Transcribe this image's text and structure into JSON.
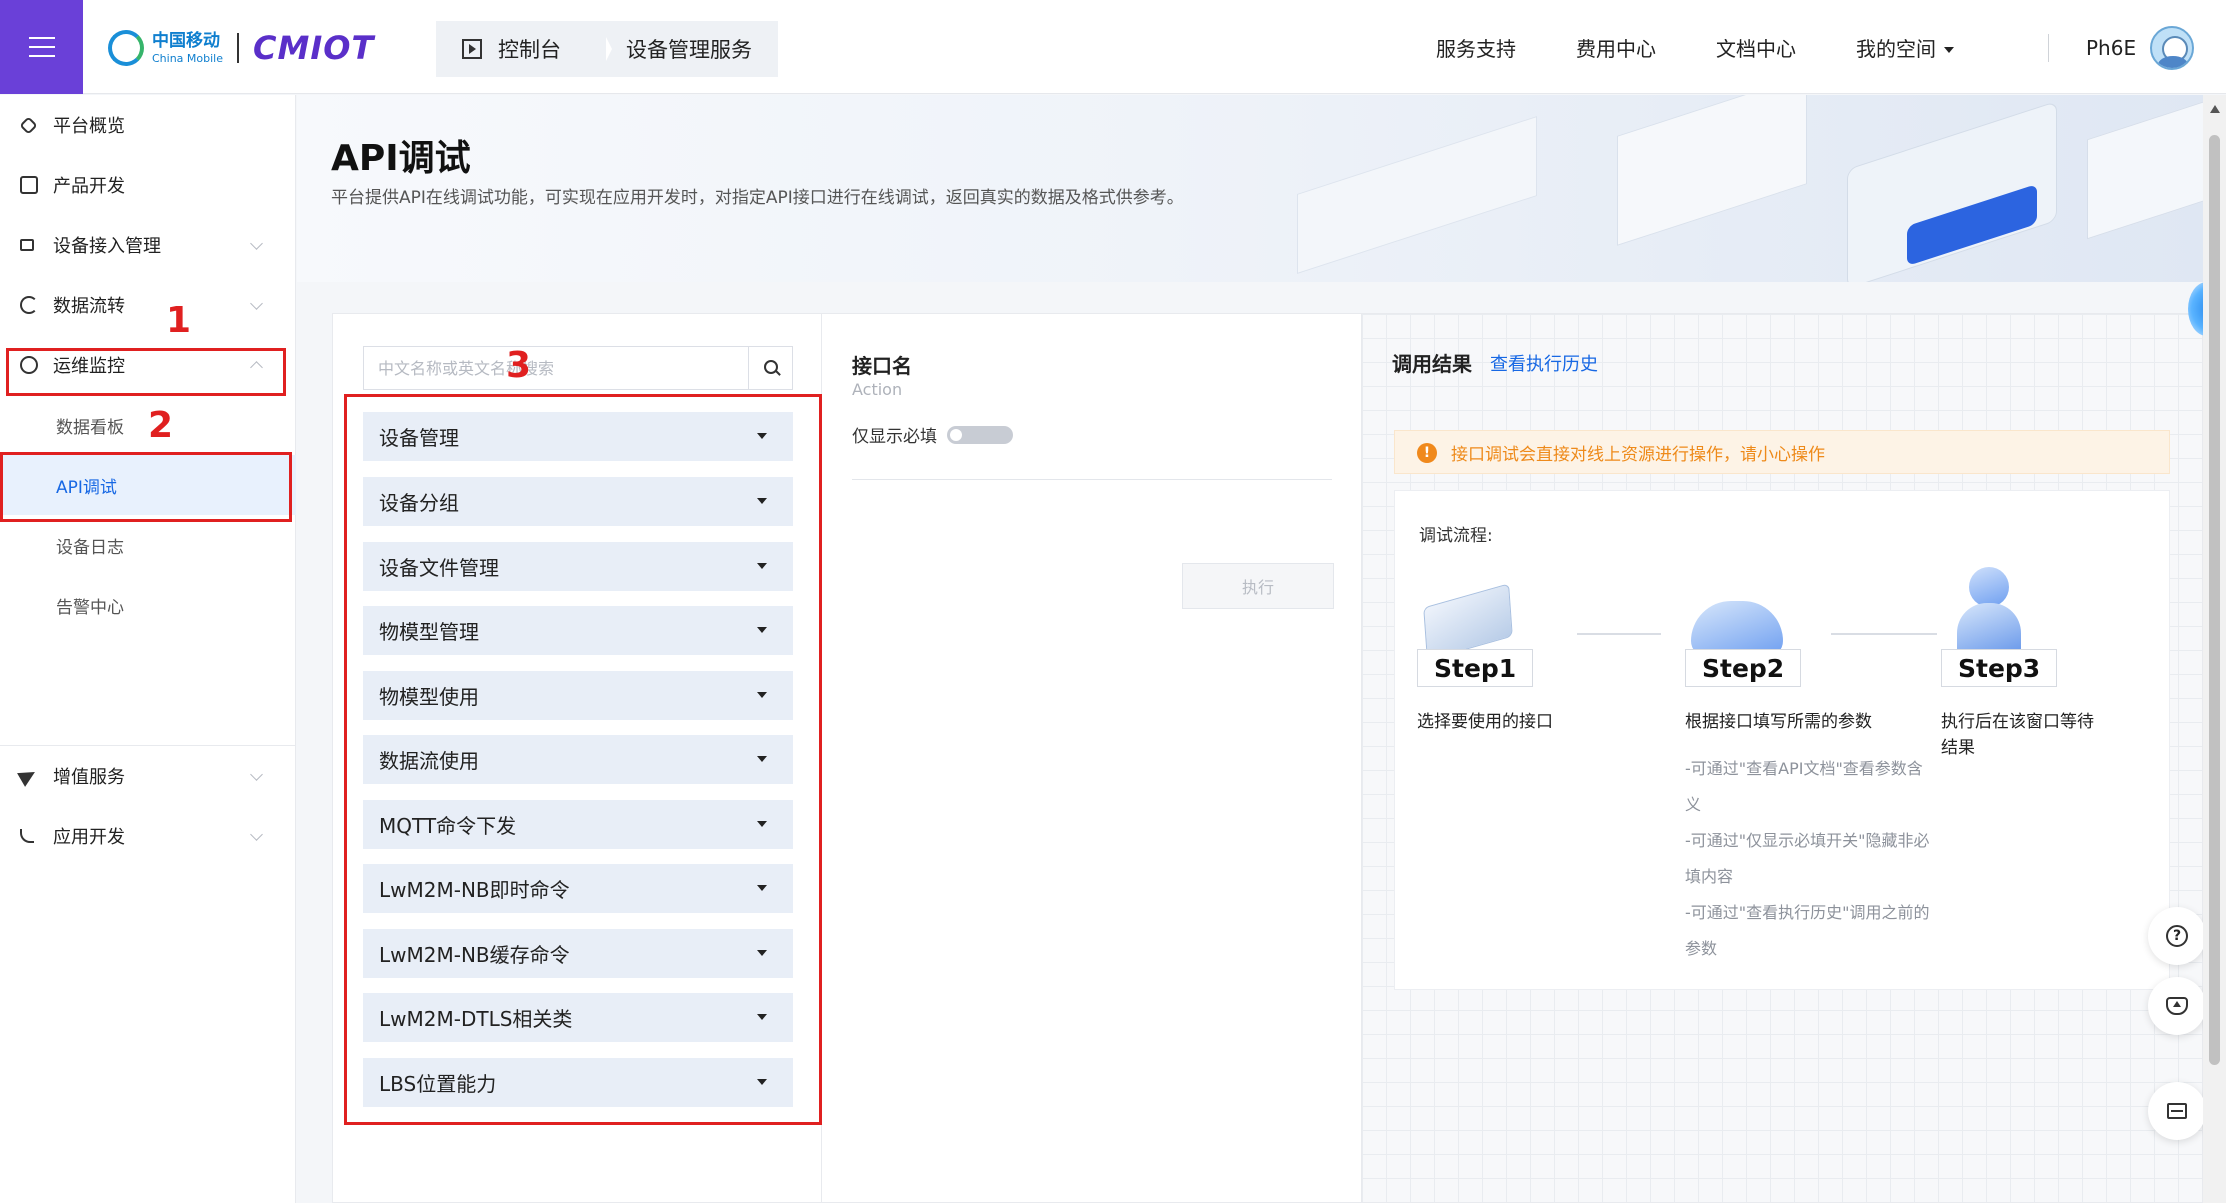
{
  "header": {
    "logo_cn": "中国移动",
    "logo_en": "China Mobile",
    "brand": "CMIOT",
    "breadcrumb": [
      "控制台",
      "设备管理服务"
    ],
    "nav": [
      "服务支持",
      "费用中心",
      "文档中心",
      "我的空间"
    ],
    "user_name": "Ph6E"
  },
  "sidebar": {
    "items": [
      {
        "label": "平台概览",
        "icon": "platform-overview-icon"
      },
      {
        "label": "产品开发",
        "icon": "cube-icon"
      },
      {
        "label": "设备接入管理",
        "icon": "device-access-icon"
      },
      {
        "label": "数据流转",
        "icon": "data-flow-icon"
      },
      {
        "label": "运维监控",
        "icon": "monitor-icon"
      }
    ],
    "sub_items": [
      "数据看板",
      "API调试",
      "设备日志",
      "告警中心"
    ],
    "bottom_items": [
      {
        "label": "增值服务",
        "icon": "send-icon"
      },
      {
        "label": "应用开发",
        "icon": "app-dev-icon"
      }
    ],
    "active_sub": "API调试"
  },
  "annotations": [
    "1",
    "2",
    "3"
  ],
  "banner": {
    "title": "API调试",
    "description": "平台提供API在线调试功能，可实现在应用开发时，对指定API接口进行在线调试，返回真实的数据及格式供参考。"
  },
  "api_list": {
    "search_placeholder": "中文名称或英文名称搜索",
    "categories": [
      "设备管理",
      "设备分组",
      "设备文件管理",
      "物模型管理",
      "物模型使用",
      "数据流使用",
      "MQTT命令下发",
      "LwM2M-NB即时命令",
      "LwM2M-NB缓存命令",
      "LwM2M-DTLS相关类",
      "LBS位置能力"
    ]
  },
  "api_detail": {
    "title": "接口名",
    "subtitle": "Action",
    "required_toggle_label": "仅显示必填",
    "execute_label": "执行"
  },
  "result": {
    "title": "调用结果",
    "history_link": "查看执行历史",
    "warning": "接口调试会直接对线上资源进行操作，请小心操作",
    "flow_title": "调试流程:",
    "steps": [
      {
        "label": "Step1",
        "desc": "选择要使用的接口"
      },
      {
        "label": "Step2",
        "desc": "根据接口填写所需的参数"
      },
      {
        "label": "Step3",
        "desc": "执行后在该窗口等待结果"
      }
    ],
    "tips": [
      "-可通过\"查看API文档\"查看参数含义",
      "-可通过\"仅显示必填开关\"隐藏非必填内容",
      "-可通过\"查看执行历史\"调用之前的参数"
    ]
  },
  "colors": {
    "brand_purple": "#6a40d8",
    "link_blue": "#1768e4",
    "annotation_red": "#e02020",
    "warning_orange": "#ee8a1a"
  }
}
